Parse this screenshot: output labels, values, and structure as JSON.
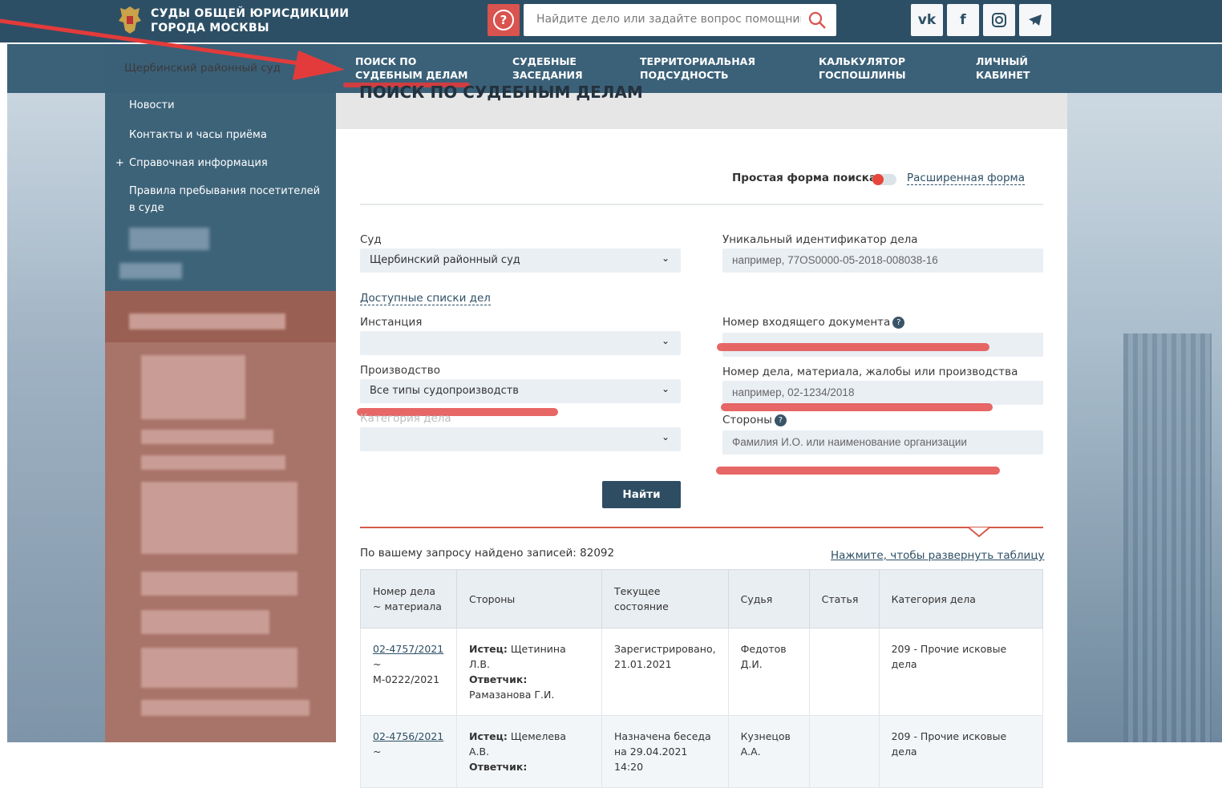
{
  "header": {
    "logo_line1": "СУДЫ ОБЩЕЙ ЮРИСДИКЦИИ",
    "logo_line2": "ГОРОДА МОСКВЫ",
    "search_placeholder": "Найдите дело или задайте вопрос помощнику",
    "help_icon": "?",
    "social": [
      "vk-icon",
      "facebook-icon",
      "instagram-icon",
      "telegram-icon"
    ]
  },
  "nav": {
    "court_selector": "Щербинский районный суд",
    "items": [
      {
        "line1": "ПОИСК ПО",
        "line2": "СУДЕБНЫМ ДЕЛАМ"
      },
      {
        "line1": "СУДЕБНЫЕ",
        "line2": "ЗАСЕДАНИЯ"
      },
      {
        "line1": "ТЕРРИТОРИАЛЬНАЯ",
        "line2": "ПОДСУДНОСТЬ"
      },
      {
        "line1": "КАЛЬКУЛЯТОР",
        "line2": "ГОСПОШЛИНЫ"
      },
      {
        "line1": "ЛИЧНЫЙ",
        "line2": "КАБИНЕТ"
      }
    ]
  },
  "sidebar": {
    "items": [
      "Новости",
      "Контакты и часы приёма",
      "Справочная информация",
      "Правила пребывания посетителей",
      "в суде"
    ],
    "plus": "+"
  },
  "page": {
    "title": "ПОИСК ПО СУДЕБНЫМ ДЕЛАМ",
    "simple_form": "Простая форма поиска",
    "advanced_form": "Расширенная форма"
  },
  "form": {
    "court_label": "Суд",
    "court_value": "Щербинский районный суд",
    "uid_label": "Уникальный идентификатор дела",
    "uid_placeholder": "например, 77OS0000-05-2018-008038-16",
    "lists_link": "Доступные списки дел",
    "instance_label": "Инстанция",
    "incoming_label": "Номер входящего документа",
    "proceeding_label": "Производство",
    "proceeding_value": "Все типы судопроизводств",
    "case_number_label": "Номер дела, материала, жалобы или производства",
    "case_number_placeholder": "например, 02-1234/2018",
    "category_label": "Категория дела",
    "parties_label": "Стороны",
    "parties_placeholder": "Фамилия И.О. или наименование организации",
    "find_button": "Найти"
  },
  "results": {
    "found_text": "По вашему запросу найдено записей: 82092",
    "expand_link": "Нажмите, чтобы развернуть таблицу",
    "headers": [
      "Номер дела ~ материала",
      "Стороны",
      "Текущее состояние",
      "Судья",
      "Статья",
      "Категория дела"
    ],
    "rows": [
      {
        "case": "02-4757/2021",
        "tilde": "~",
        "material": "М-0222/2021",
        "plaintiff_label": "Истец:",
        "plaintiff": "Щетинина Л.В.",
        "defendant_label": "Ответчик:",
        "defendant": "Рамазанова Г.И.",
        "status": "Зарегистрировано, 21.01.2021",
        "judge": "Федотов Д.И.",
        "article": "",
        "category": "209 - Прочие исковые дела"
      },
      {
        "case": "02-4756/2021",
        "tilde": "~",
        "material": "",
        "plaintiff_label": "Истец:",
        "plaintiff": "Щемелева А.В.",
        "defendant_label": "Ответчик:",
        "defendant": "",
        "status": "Назначена беседа на 29.04.2021 14:20",
        "judge": "Кузнецов А.А.",
        "article": "",
        "category": "209 - Прочие исковые дела"
      }
    ]
  }
}
